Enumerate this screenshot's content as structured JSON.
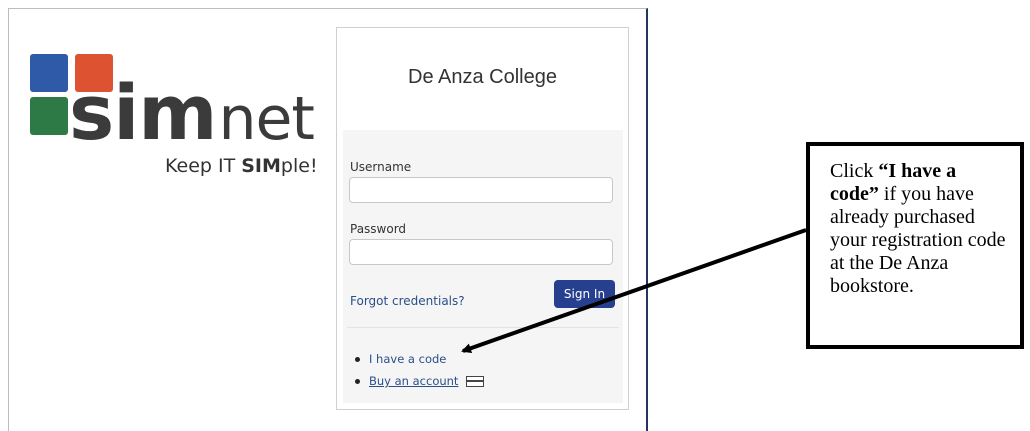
{
  "logo": {
    "brand_sim": "sim",
    "brand_net": "net",
    "tagline_prefix": "Keep IT ",
    "tagline_sim": "SIM",
    "tagline_suffix": "ple!"
  },
  "login": {
    "school_name": "De Anza College",
    "username_label": "Username",
    "username_value": "",
    "password_label": "Password",
    "password_value": "",
    "forgot_link": "Forgot credentials?",
    "signin_button": "Sign In",
    "links": {
      "code": "I have a code",
      "buy": "Buy an account"
    }
  },
  "callout": {
    "prefix": "Click ",
    "bold": "“I have a code”",
    "suffix": " if you have already purchased your registration code at the De Anza bookstore."
  },
  "icons": {
    "card": "credit-card-icon",
    "bullet": "bullet-icon"
  },
  "colors": {
    "logo_blue": "#2f5aa8",
    "logo_orange": "#dd5230",
    "logo_green": "#2e7a46",
    "signin_button": "#263f8f",
    "link": "#2a4f8a"
  }
}
